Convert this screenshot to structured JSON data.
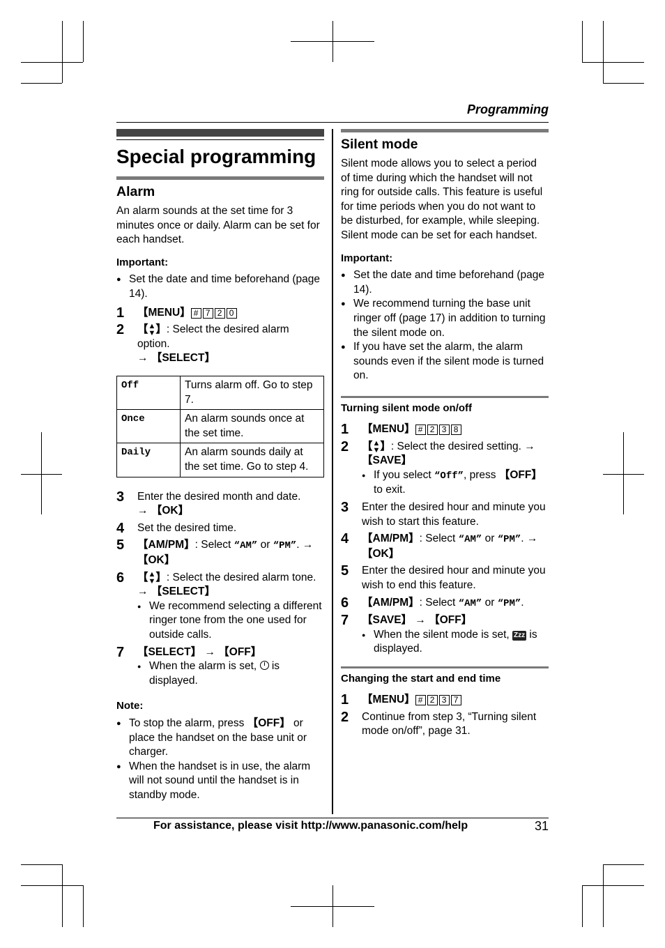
{
  "header": {
    "running_head": "Programming"
  },
  "left": {
    "title": "Special programming",
    "section": "Alarm",
    "intro": "An alarm sounds at the set time for 3 minutes once or daily. Alarm can be set for each handset.",
    "important_label": "Important:",
    "important": [
      "Set the date and time beforehand (page 14)."
    ],
    "steps": {
      "s1": {
        "num": "1",
        "key": "【MENU】",
        "boxes": [
          "#",
          "7",
          "2",
          "0"
        ]
      },
      "s2": {
        "num": "2",
        "key_open": "【",
        "key_close": "】",
        "text": ": Select the desired alarm option.",
        "arrow": "→",
        "action": "【SELECT】"
      },
      "s3": {
        "num": "3",
        "text": "Enter the desired month and date.",
        "arrow": "→",
        "action": "【OK】"
      },
      "s4": {
        "num": "4",
        "text": "Set the desired time."
      },
      "s5": {
        "num": "5",
        "key": "【AM/PM】",
        "text1": ": Select ",
        "q1": "“AM”",
        "or": " or ",
        "q2": "“PM”",
        "text2": ". →",
        "action": "【OK】"
      },
      "s6": {
        "num": "6",
        "key_open": "【",
        "key_close": "】",
        "text": ": Select the desired alarm tone.",
        "arrow": "→",
        "action": "【SELECT】",
        "note": "We recommend selecting a different ringer tone from the one used for outside calls."
      },
      "s7": {
        "num": "7",
        "action1": "【SELECT】",
        "arrow": " → ",
        "action2": "【OFF】",
        "note_before": "When the alarm is set, ",
        "note_after": " is displayed."
      }
    },
    "options": [
      {
        "code": "Off",
        "desc": "Turns alarm off. Go to step 7."
      },
      {
        "code": "Once",
        "desc": "An alarm sounds once at the set time."
      },
      {
        "code": "Daily",
        "desc": "An alarm sounds daily at the set time. Go to step 4."
      }
    ],
    "note_label": "Note:",
    "notes": {
      "n1_before": "To stop the alarm, press ",
      "n1_key": "【OFF】",
      "n1_after": " or place the handset on the base unit or charger.",
      "n2": "When the handset is in use, the alarm will not sound until the handset is in standby mode."
    }
  },
  "right": {
    "section": "Silent mode",
    "intro": "Silent mode allows you to select a period of time during which the handset will not ring for outside calls. This feature is useful for time periods when you do not want to be disturbed, for example, while sleeping. Silent mode can be set for each handset.",
    "important_label": "Important:",
    "important": [
      "Set the date and time beforehand (page 14).",
      "We recommend turning the base unit ringer off (page 17) in addition to turning the silent mode on.",
      "If you have set the alarm, the alarm sounds even if the silent mode is turned on."
    ],
    "sub1": {
      "title": "Turning silent mode on/off",
      "s1": {
        "num": "1",
        "key": "【MENU】",
        "boxes": [
          "#",
          "2",
          "3",
          "8"
        ]
      },
      "s2": {
        "num": "2",
        "key_open": "【",
        "key_close": "】",
        "text": ": Select the desired setting. →",
        "action": "【SAVE】",
        "note_before": "If you select ",
        "note_code": "“Off”",
        "note_mid": ", press ",
        "note_key": "【OFF】",
        "note_after": " to exit."
      },
      "s3": {
        "num": "3",
        "text": "Enter the desired hour and minute you wish to start this feature."
      },
      "s4": {
        "num": "4",
        "key": "【AM/PM】",
        "text1": ": Select ",
        "q1": "“AM”",
        "or": " or ",
        "q2": "“PM”",
        "text2": ". →",
        "action": "【OK】"
      },
      "s5": {
        "num": "5",
        "text": "Enter the desired hour and minute you wish to end this feature."
      },
      "s6": {
        "num": "6",
        "key": "【AM/PM】",
        "text1": ": Select ",
        "q1": "“AM”",
        "or": " or ",
        "q2": "“PM”",
        "text2": "."
      },
      "s7": {
        "num": "7",
        "action1": "【SAVE】",
        "arrow": " → ",
        "action2": "【OFF】",
        "note_before": "When the silent mode is set, ",
        "icon_text": "Zzz",
        "note_after": " is displayed."
      }
    },
    "sub2": {
      "title": "Changing the start and end time",
      "s1": {
        "num": "1",
        "key": "【MENU】",
        "boxes": [
          "#",
          "2",
          "3",
          "7"
        ]
      },
      "s2": {
        "num": "2",
        "text": "Continue from step 3, “Turning silent mode on/off”, page 31."
      }
    }
  },
  "footer": {
    "text": "For assistance, please visit http://www.panasonic.com/help",
    "page": "31"
  }
}
